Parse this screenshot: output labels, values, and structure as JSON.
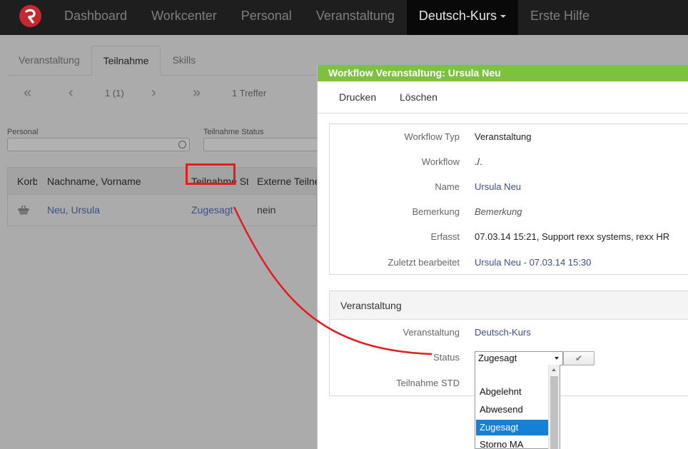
{
  "nav": {
    "items": [
      "Dashboard",
      "Workcenter",
      "Personal",
      "Veranstaltung",
      "Deutsch-Kurs",
      "Erste Hilfe"
    ],
    "active": "Deutsch-Kurs"
  },
  "tabs": [
    "Veranstaltung",
    "Teilnahme",
    "Skills"
  ],
  "active_tab": "Teilnahme",
  "pager": {
    "page": "1 (1)",
    "hits": "1 Treffer"
  },
  "filters": {
    "personal_label": "Personal",
    "status_label": "Teilnahme Status"
  },
  "grid": {
    "columns": [
      "Korb",
      "Nachname, Vorname",
      "Teilnahme St",
      "Externe Teilne"
    ],
    "row": {
      "name": "Neu, Ursula",
      "status": "Zugesagt",
      "extern": "nein"
    }
  },
  "panel": {
    "title": "Workflow Veranstaltung: Ursula Neu",
    "toolbar": [
      "Drucken",
      "Löschen"
    ],
    "details": [
      {
        "label": "Workflow Typ",
        "value": "Veranstaltung"
      },
      {
        "label": "Workflow",
        "value": "./."
      },
      {
        "label": "Name",
        "value": "Ursula Neu"
      },
      {
        "label": "Bemerkung",
        "value": "Bemerkung"
      },
      {
        "label": "Erfasst",
        "value": "07.03.14 15:21, Support rexx systems, rexx HR"
      },
      {
        "label": "Zuletzt bearbeitet",
        "value": "Ursula Neu - 07.03.14 15:30"
      }
    ],
    "section2": {
      "title": "Veranstaltung",
      "veranstaltung_label": "Veranstaltung",
      "veranstaltung_value": "Deutsch-Kurs",
      "status_label": "Status",
      "status_value": "Zugesagt",
      "std_label": "Teilnahme STD"
    },
    "dropdown_options": [
      "",
      "Abgelehnt",
      "Abwesend",
      "Zugesagt",
      "Storno MA"
    ],
    "dropdown_selected": "Zugesagt"
  },
  "colors": {
    "panel_header": "#7cc140",
    "selected_option": "#1480d6",
    "annotation": "#e41c1c",
    "link": "#3c4f8a"
  }
}
